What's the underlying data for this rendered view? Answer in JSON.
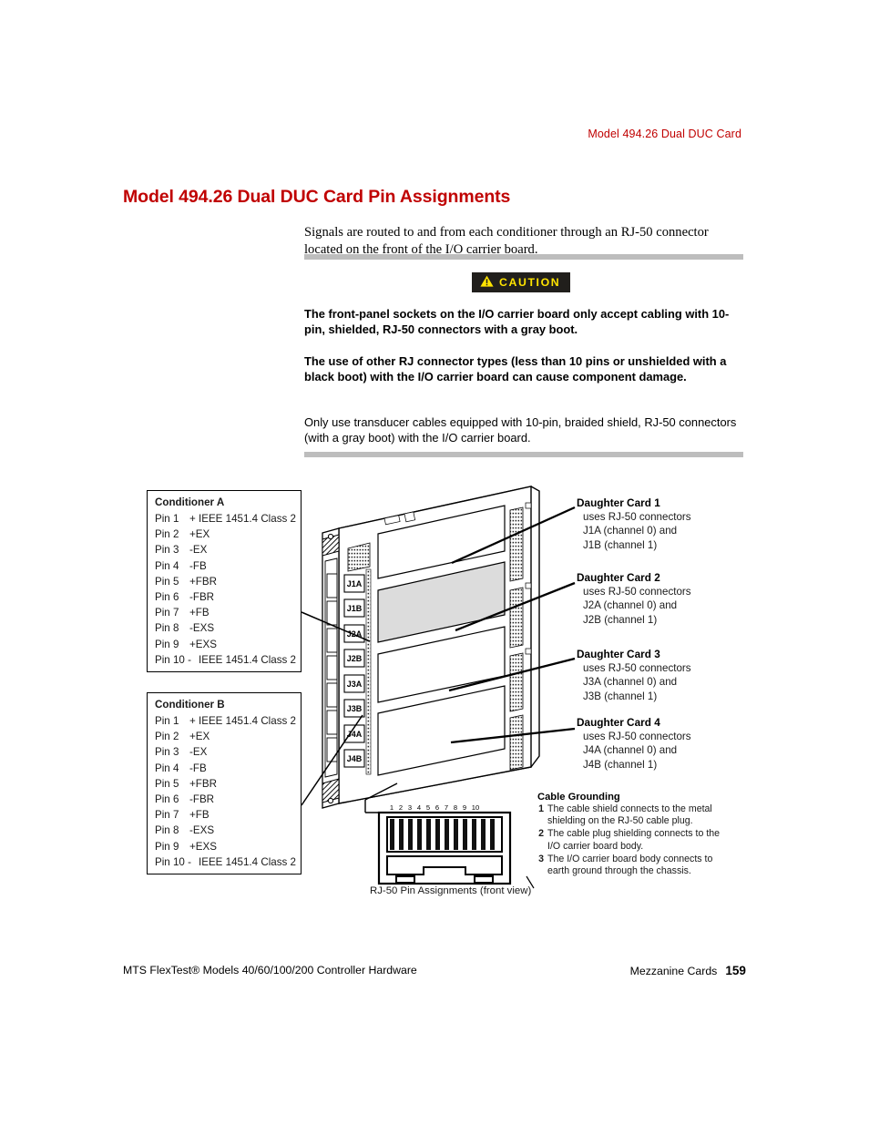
{
  "header": {
    "running_head": "Model 494.26 Dual DUC Card"
  },
  "section": {
    "title": "Model 494.26 Dual DUC Card Pin Assignments",
    "intro": "Signals are routed to and from each conditioner through an RJ-50 connector located on the front of the I/O carrier board."
  },
  "caution": {
    "badge_label": "CAUTION",
    "warning_icon": "warning-triangle-icon",
    "paragraph_1": "The front-panel sockets on the I/O carrier board only accept cabling with 10-pin, shielded, RJ-50 connectors with a gray boot.",
    "paragraph_2": "The use of other RJ connector types (less than 10 pins or unshielded with a black boot) with the I/O carrier board can cause component damage.",
    "paragraph_3": "Only use transducer cables equipped with 10-pin, braided shield, RJ-50 connectors (with a gray boot) with the I/O carrier board."
  },
  "conditioner_a": {
    "title": "Conditioner A",
    "rows": [
      {
        "pin": "Pin 1",
        "signal": "+ IEEE 1451.4 Class 2"
      },
      {
        "pin": "Pin 2",
        "signal": "+EX"
      },
      {
        "pin": "Pin 3",
        "signal": "-EX"
      },
      {
        "pin": "Pin 4",
        "signal": "-FB"
      },
      {
        "pin": "Pin 5",
        "signal": "+FBR"
      },
      {
        "pin": "Pin 6",
        "signal": "-FBR"
      },
      {
        "pin": "Pin 7",
        "signal": "+FB"
      },
      {
        "pin": "Pin 8",
        "signal": "-EXS"
      },
      {
        "pin": "Pin 9",
        "signal": "+EXS"
      },
      {
        "pin": "Pin 10 -",
        "signal": "IEEE 1451.4 Class 2"
      }
    ]
  },
  "conditioner_b": {
    "title": "Conditioner B",
    "rows": [
      {
        "pin": "Pin 1",
        "signal": "+ IEEE 1451.4 Class 2"
      },
      {
        "pin": "Pin 2",
        "signal": "+EX"
      },
      {
        "pin": "Pin 3",
        "signal": "-EX"
      },
      {
        "pin": "Pin 4",
        "signal": "-FB"
      },
      {
        "pin": "Pin 5",
        "signal": "+FBR"
      },
      {
        "pin": "Pin 6",
        "signal": "-FBR"
      },
      {
        "pin": "Pin 7",
        "signal": "+FB"
      },
      {
        "pin": "Pin 8",
        "signal": "-EXS"
      },
      {
        "pin": "Pin 9",
        "signal": "+EXS"
      },
      {
        "pin": "Pin 10 -",
        "signal": "IEEE 1451.4 Class 2"
      }
    ]
  },
  "daughter_cards": [
    {
      "title": "Daughter Card 1",
      "line1": "uses RJ-50 connectors",
      "line2": "J1A (channel 0) and",
      "line3": "J1B (channel 1)"
    },
    {
      "title": "Daughter Card 2",
      "line1": "uses RJ-50 connectors",
      "line2": "J2A (channel 0) and",
      "line3": "J2B (channel 1)"
    },
    {
      "title": "Daughter Card 3",
      "line1": "uses RJ-50 connectors",
      "line2": "J3A (channel 0) and",
      "line3": "J3B (channel 1)"
    },
    {
      "title": "Daughter Card 4",
      "line1": "uses RJ-50 connectors",
      "line2": "J4A (channel 0) and",
      "line3": "J4B (channel 1)"
    }
  ],
  "cable_grounding": {
    "title": "Cable Grounding",
    "items": [
      {
        "num": "1",
        "text": "The cable shield connects to the metal shielding on the RJ-50 cable plug."
      },
      {
        "num": "2",
        "text": "The cable plug shielding connects to the I/O carrier board body."
      },
      {
        "num": "3",
        "text": "The I/O carrier board body connects to earth ground through the chassis."
      }
    ]
  },
  "rj50_figure": {
    "caption": "RJ-50 Pin Assignments (front view)",
    "pin_numbers": [
      "1",
      "2",
      "3",
      "4",
      "5",
      "6",
      "7",
      "8",
      "9",
      "10"
    ]
  },
  "board_connectors": [
    "J1A",
    "J1B",
    "J2A",
    "J2B",
    "J3A",
    "J3B",
    "J4A",
    "J4B"
  ],
  "footer": {
    "left": "MTS FlexTest® Models 40/60/100/200 Controller Hardware",
    "right": "Mezzanine Cards",
    "page": "159"
  },
  "colors": {
    "heading_red": "#c00000",
    "caution_bg": "#211f1c",
    "caution_fg": "#ffe400",
    "rule_gray": "#bdbdbd"
  }
}
